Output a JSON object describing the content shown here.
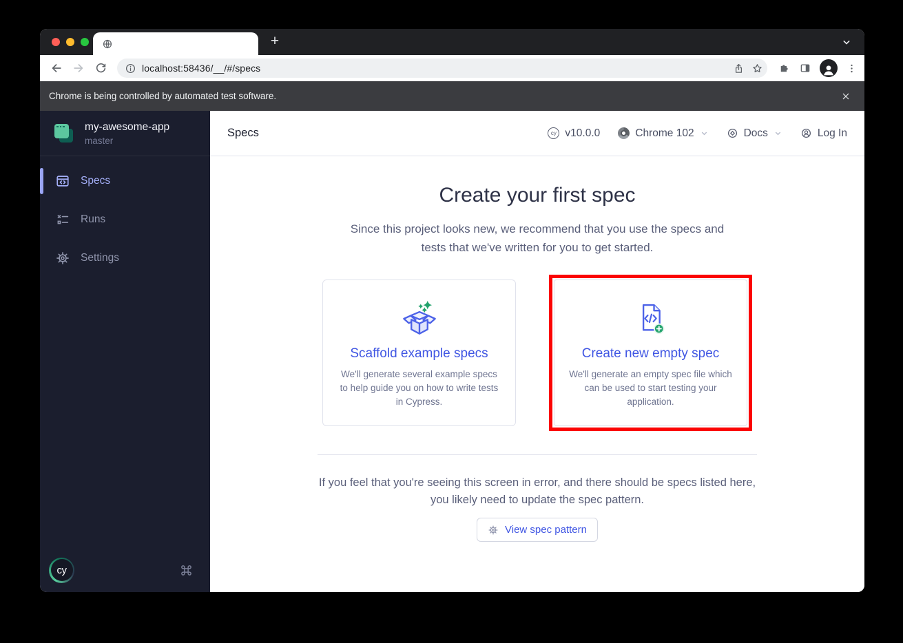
{
  "browser": {
    "url": "localhost:58436/__/#/specs",
    "new_tab_glyph": "+",
    "infobar_message": "Chrome is being controlled by automated test software."
  },
  "sidebar": {
    "project": {
      "name": "my-awesome-app",
      "branch": "master"
    },
    "nav": [
      {
        "label": "Specs",
        "active": true
      },
      {
        "label": "Runs",
        "active": false
      },
      {
        "label": "Settings",
        "active": false
      }
    ],
    "footer": {
      "logo_text": "cy",
      "shortcut_icon": "command-key"
    }
  },
  "header": {
    "title": "Specs",
    "version": "v10.0.0",
    "browser_select": "Chrome 102",
    "docs_label": "Docs",
    "login_label": "Log In"
  },
  "main": {
    "heading": "Create your first spec",
    "subheading_line1": "Since this project looks new, we recommend that you use the specs and",
    "subheading_line2": "tests that we've written for you to get started.",
    "cards": [
      {
        "title": "Scaffold example specs",
        "description": "We'll generate several example specs to help guide you on how to write tests in Cypress.",
        "highlighted": false
      },
      {
        "title": "Create new empty spec",
        "description": "We'll generate an empty spec file which can be used to start testing your application.",
        "highlighted": true
      }
    ],
    "note_line1": "If you feel that you're seeing this screen in error, and there should be specs listed here,",
    "note_line2": "you likely need to update the spec pattern.",
    "view_spec_pattern_label": "View spec pattern"
  },
  "colors": {
    "accent_indigo": "#4056e3",
    "nav_active_indigo": "#a3aef7",
    "jade_green": "#1fa970",
    "highlight_red": "#fb0404",
    "sidebar_bg": "#1b1e2e",
    "tabstrip_bg": "#202124",
    "infobar_bg": "#3b3c40"
  }
}
